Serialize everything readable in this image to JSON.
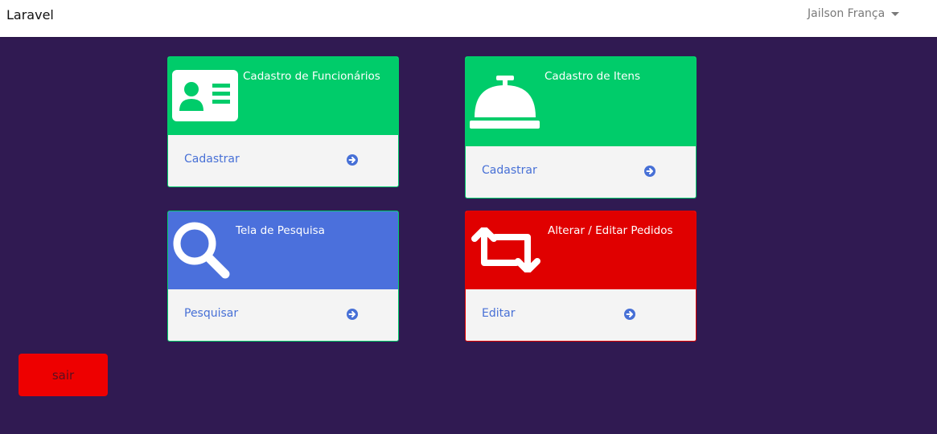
{
  "navbar": {
    "brand": "Laravel",
    "user_name": "Jailson França"
  },
  "cards": {
    "funcionarios": {
      "title": "Cadastro de Funcionários",
      "link": "Cadastrar",
      "color": "#00cc6a",
      "icon": "id-card-icon"
    },
    "itens": {
      "title": "Cadastro de Itens",
      "link": "Cadastrar",
      "color": "#00cc6a",
      "icon": "service-bell-icon"
    },
    "pesquisa": {
      "title": "Tela de Pesquisa",
      "link": "Pesquisar",
      "color": "#4b70dc",
      "icon": "search-icon"
    },
    "pedidos": {
      "title": "Alterar / Editar Pedidos",
      "link": "Editar",
      "color": "#e00000",
      "icon": "retweet-icon"
    }
  },
  "sair_button": {
    "label": "sair",
    "color": "#ee0000"
  },
  "theme": {
    "background": "#301a52",
    "link_color": "#4770d6"
  }
}
